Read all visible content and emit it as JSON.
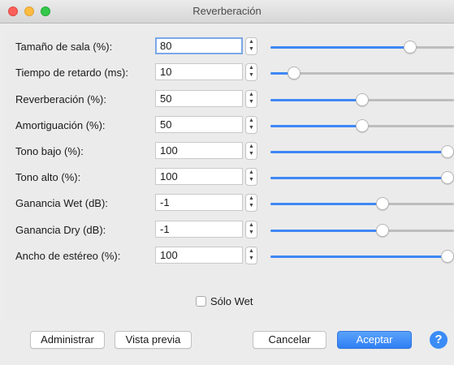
{
  "window": {
    "title": "Reverberación"
  },
  "params": [
    {
      "label": "Tamaño de sala (%):",
      "value": "80",
      "focused": true,
      "fraction": 0.78
    },
    {
      "label": "Tiempo de retardo (ms):",
      "value": "10",
      "focused": false,
      "fraction": 0.1
    },
    {
      "label": "Reverberación (%):",
      "value": "50",
      "focused": false,
      "fraction": 0.5
    },
    {
      "label": "Amortiguación (%):",
      "value": "50",
      "focused": false,
      "fraction": 0.5
    },
    {
      "label": "Tono bajo (%):",
      "value": "100",
      "focused": false,
      "fraction": 1.0
    },
    {
      "label": "Tono alto (%):",
      "value": "100",
      "focused": false,
      "fraction": 1.0
    },
    {
      "label": "Ganancia Wet (dB):",
      "value": "-1",
      "focused": false,
      "fraction": 0.62
    },
    {
      "label": "Ganancia Dry (dB):",
      "value": "-1",
      "focused": false,
      "fraction": 0.62
    },
    {
      "label": "Ancho de estéreo (%):",
      "value": "100",
      "focused": false,
      "fraction": 1.0
    }
  ],
  "wet_only": {
    "label": "Sólo Wet",
    "checked": false
  },
  "buttons": {
    "manage": "Administrar",
    "preview": "Vista previa",
    "cancel": "Cancelar",
    "ok": "Aceptar",
    "help": "?"
  },
  "colors": {
    "accent": "#3f87f5",
    "focus_ring": "#7aa7e9"
  }
}
